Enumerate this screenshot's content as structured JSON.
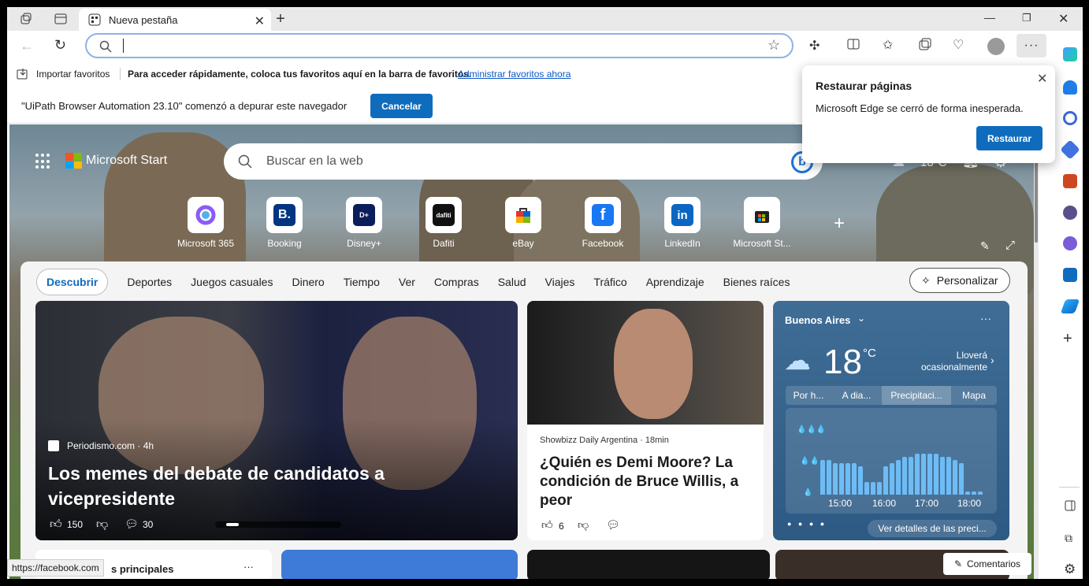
{
  "tab": {
    "title": "Nueva pestaña"
  },
  "favbar": {
    "import": "Importar favoritos",
    "hint": "Para acceder rápidamente, coloca tus favoritos aquí en la barra de favoritos.",
    "manage": "Administrar favoritos ahora"
  },
  "infobar": {
    "message": "\"UiPath Browser Automation 23.10\" comenzó a depurar este navegador",
    "cancel": "Cancelar"
  },
  "popup": {
    "title": "Restaurar páginas",
    "body": "Microsoft Edge se cerró de forma inesperada.",
    "restore": "Restaurar"
  },
  "start": {
    "logo": "Microsoft Start",
    "search_placeholder": "Buscar en la web",
    "temp": "18°C"
  },
  "tiles": [
    {
      "label": "Microsoft 365"
    },
    {
      "label": "Booking"
    },
    {
      "label": "Disney+"
    },
    {
      "label": "Dafiti"
    },
    {
      "label": "eBay"
    },
    {
      "label": "Facebook"
    },
    {
      "label": "LinkedIn"
    },
    {
      "label": "Microsoft St..."
    }
  ],
  "nav": {
    "items": [
      "Descubrir",
      "Deportes",
      "Juegos casuales",
      "Dinero",
      "Tiempo",
      "Ver",
      "Compras",
      "Salud",
      "Viajes",
      "Tráfico",
      "Aprendizaje",
      "Bienes raíces"
    ],
    "personalize": "Personalizar"
  },
  "main_card": {
    "source": "Periodismo.com · 4h",
    "headline": "Los memes del debate de candidatos a vicepresidente",
    "likes": "150",
    "comments": "30"
  },
  "news_card": {
    "source": "Showbizz Daily Argentina · 18min",
    "headline": "¿Quién es Demi Moore? La condición de Bruce Willis, a peor",
    "likes": "6"
  },
  "weather": {
    "city": "Buenos Aires",
    "temp": "18",
    "unit": "°C",
    "desc": "Lloverá ocasionalmente",
    "tabs": [
      "Por h...",
      "A dia...",
      "Precipitaci...",
      "Mapa"
    ],
    "times": [
      "15:00",
      "16:00",
      "17:00",
      "18:00"
    ],
    "details": "Ver detalles de las preci...",
    "precip_levels": [
      0.55,
      0.55,
      0.5,
      0.5,
      0.5,
      0.5,
      0.45,
      0.2,
      0.2,
      0.2,
      0.45,
      0.5,
      0.55,
      0.6,
      0.6,
      0.65,
      0.65,
      0.65,
      0.65,
      0.6,
      0.6,
      0.55,
      0.5,
      0.05,
      0.05,
      0.05
    ]
  },
  "bottom": {
    "top_stories": "s principales",
    "feedback": "Comentarios"
  },
  "status": {
    "url": "https://facebook.com"
  },
  "colors": {
    "accent": "#0f6cbd",
    "weather_bg": "#3f6d95"
  }
}
